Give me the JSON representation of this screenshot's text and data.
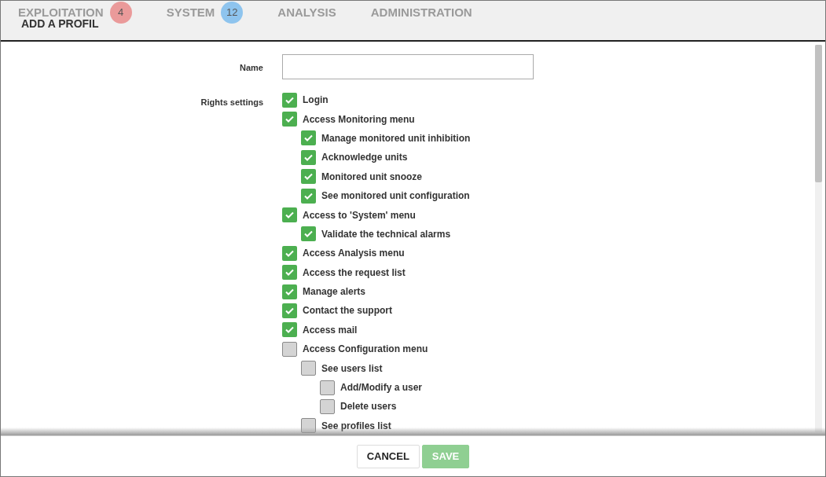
{
  "background_nav": [
    {
      "label": "EXPLOITATION",
      "badge": "4",
      "color": "#ea9a9a"
    },
    {
      "label": "SYSTEM",
      "badge": "12",
      "color": "#8ec4ee"
    },
    {
      "label": "ANALYSIS"
    },
    {
      "label": "ADMINISTRATION"
    }
  ],
  "dialog": {
    "title": "ADD A PROFIL",
    "name_field": {
      "label": "Name"
    },
    "rights": {
      "label": "Rights settings",
      "items": [
        {
          "label": "Login",
          "checked": true
        },
        {
          "label": "Access Monitoring menu",
          "checked": true,
          "children": [
            {
              "label": "Manage monitored unit inhibition",
              "checked": true
            },
            {
              "label": "Acknowledge units",
              "checked": true
            },
            {
              "label": "Monitored unit snooze",
              "checked": true
            },
            {
              "label": "See monitored unit configuration",
              "checked": true
            }
          ]
        },
        {
          "label": "Access to 'System' menu",
          "checked": true,
          "children": [
            {
              "label": "Validate the technical alarms",
              "checked": true
            }
          ]
        },
        {
          "label": "Access Analysis menu",
          "checked": true
        },
        {
          "label": "Access the request list",
          "checked": true
        },
        {
          "label": "Manage alerts",
          "checked": true
        },
        {
          "label": "Contact the support",
          "checked": true
        },
        {
          "label": "Access mail",
          "checked": true
        },
        {
          "label": "Access Configuration menu",
          "checked": false,
          "children": [
            {
              "label": "See users list",
              "checked": false,
              "children": [
                {
                  "label": "Add/Modify a user",
                  "checked": false
                },
                {
                  "label": "Delete users",
                  "checked": false
                }
              ]
            },
            {
              "label": "See profiles list",
              "checked": false
            }
          ]
        }
      ]
    },
    "buttons": [
      {
        "label": "CANCEL",
        "kind": "secondary"
      },
      {
        "label": "SAVE",
        "kind": "primary",
        "disabled": true
      }
    ]
  }
}
